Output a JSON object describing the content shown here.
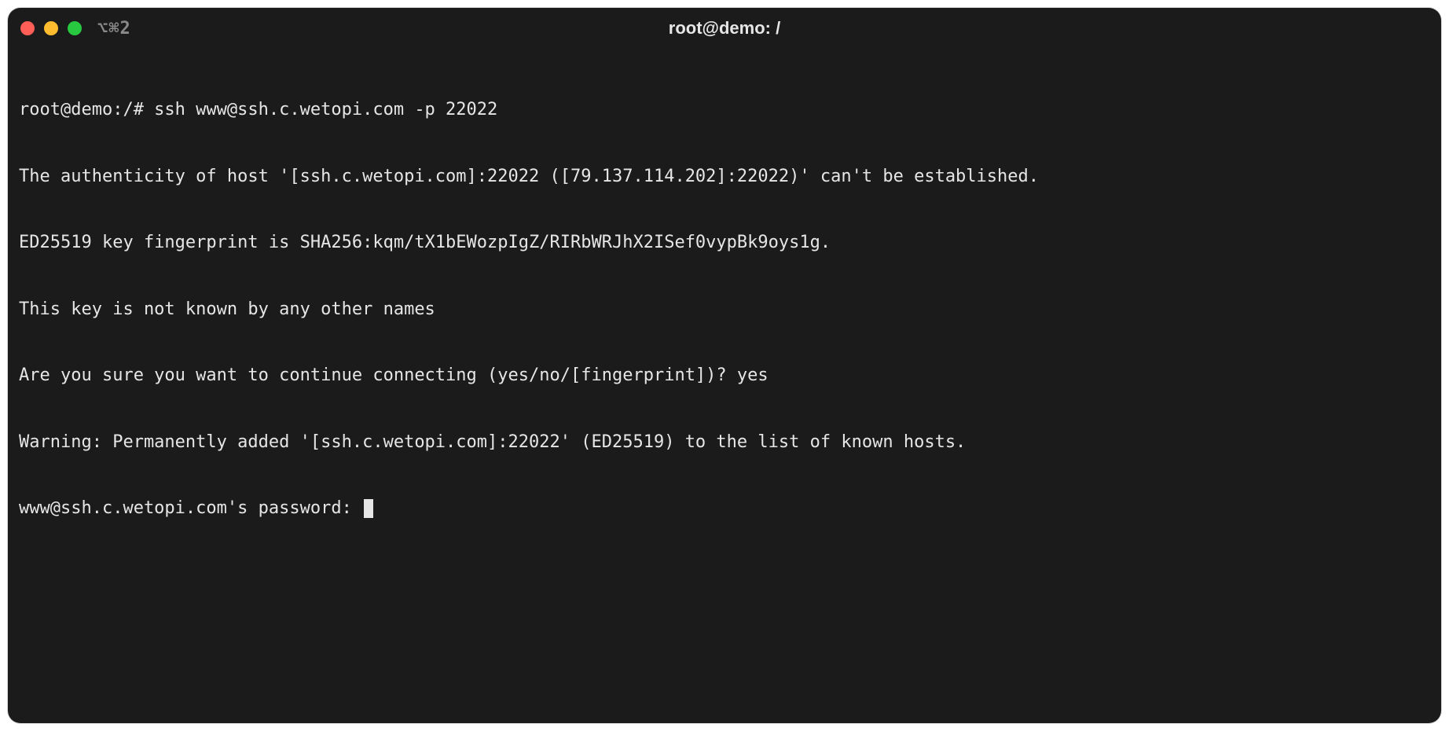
{
  "window": {
    "tab_label": "⌥⌘2",
    "title": "root@demo: /"
  },
  "terminal": {
    "lines": [
      "root@demo:/# ssh www@ssh.c.wetopi.com -p 22022",
      "The authenticity of host '[ssh.c.wetopi.com]:22022 ([79.137.114.202]:22022)' can't be established.",
      "ED25519 key fingerprint is SHA256:kqm/tX1bEWozpIgZ/RIRbWRJhX2ISef0vypBk9oys1g.",
      "This key is not known by any other names",
      "Are you sure you want to continue connecting (yes/no/[fingerprint])? yes",
      "Warning: Permanently added '[ssh.c.wetopi.com]:22022' (ED25519) to the list of known hosts.",
      "www@ssh.c.wetopi.com's password: "
    ]
  }
}
